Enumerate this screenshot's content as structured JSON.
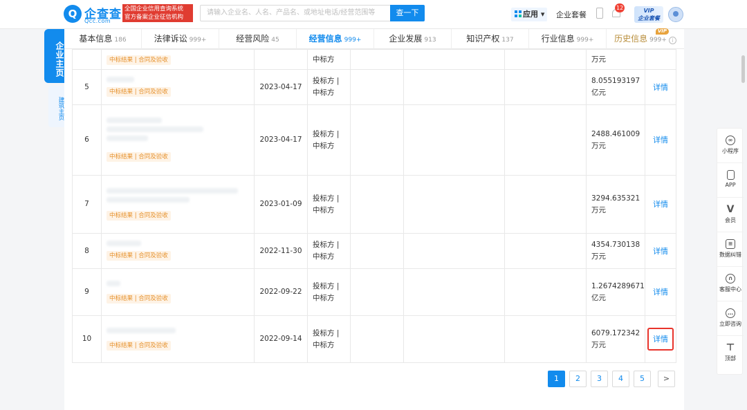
{
  "header": {
    "logo_text": "企查查",
    "logo_sub": "Qcc.com",
    "slogan_line1": "全国企业信用查询系统",
    "slogan_line2": "官方备案企业征信机构",
    "search_placeholder": "请输入企业名、人名、产品名、或地址电话/经营范围等",
    "search_button": "查一下",
    "app_label": "应用",
    "package_label": "企业套餐",
    "notification_count": "12",
    "vip_line1": "VIP",
    "vip_line2": "企业套餐"
  },
  "side": {
    "main_label": "企业主页",
    "sub_label": "建筑主页"
  },
  "tabs": [
    {
      "label": "基本信息",
      "count": "186"
    },
    {
      "label": "法律诉讼",
      "count": "999+"
    },
    {
      "label": "经营风险",
      "count": "45"
    },
    {
      "label": "经营信息",
      "count": "999+"
    },
    {
      "label": "企业发展",
      "count": "913"
    },
    {
      "label": "知识产权",
      "count": "137"
    },
    {
      "label": "行业信息",
      "count": "999+"
    },
    {
      "label": "历史信息",
      "count": "999+",
      "vip": "VIP"
    }
  ],
  "table": {
    "rows": [
      {
        "idx": "",
        "tag": "中标结果 | 合同及验收",
        "date": "",
        "role1": "",
        "role2": "中标方",
        "amount1": "",
        "amount2": "万元",
        "detail": ""
      },
      {
        "idx": "5",
        "tag": "中标结果 | 合同及验收",
        "date": "2023-04-17",
        "role1": "投标方 |",
        "role2": "中标方",
        "amount1": "8.055193197",
        "amount2": "亿元",
        "detail": "详情"
      },
      {
        "idx": "6",
        "tag": "中标结果 | 合同及验收",
        "date": "2023-04-17",
        "role1": "投标方 |",
        "role2": "中标方",
        "amount1": "2488.461009",
        "amount2": "万元",
        "detail": "详情"
      },
      {
        "idx": "7",
        "tag": "中标结果 | 合同及验收",
        "date": "2023-01-09",
        "role1": "投标方 |",
        "role2": "中标方",
        "amount1": "3294.635321",
        "amount2": "万元",
        "detail": "详情"
      },
      {
        "idx": "8",
        "tag": "中标结果 | 合同及验收",
        "date": "2022-11-30",
        "role1": "投标方 |",
        "role2": "中标方",
        "amount1": "4354.730138",
        "amount2": "万元",
        "detail": "详情"
      },
      {
        "idx": "9",
        "tag": "中标结果 | 合同及验收",
        "date": "2022-09-22",
        "role1": "投标方 |",
        "role2": "中标方",
        "amount1": "1.2674289671",
        "amount2": "亿元",
        "detail": "详情"
      },
      {
        "idx": "10",
        "tag": "中标结果 | 合同及验收",
        "date": "2022-09-14",
        "role1": "投标方 |",
        "role2": "中标方",
        "amount1": "6079.172342",
        "amount2": "万元",
        "detail": "详情"
      }
    ]
  },
  "pagination": {
    "pages": [
      "1",
      "2",
      "3",
      "4",
      "5"
    ],
    "current": "1",
    "next": ">"
  },
  "float_bar": [
    {
      "label": "小程序",
      "icon": "mini-program-icon"
    },
    {
      "label": "APP",
      "icon": "phone-icon"
    },
    {
      "label": "会员",
      "icon": "vip-icon"
    },
    {
      "label": "数据纠错",
      "icon": "edit-icon"
    },
    {
      "label": "客服中心",
      "icon": "headset-icon"
    },
    {
      "label": "立即咨询",
      "icon": "chat-icon"
    },
    {
      "label": "顶部",
      "icon": "back-to-top-icon"
    }
  ],
  "colors": {
    "brand": "#128bed",
    "tag_bg": "#fef3e6",
    "tag_text": "#e6912c",
    "highlight": "#e8332b"
  }
}
